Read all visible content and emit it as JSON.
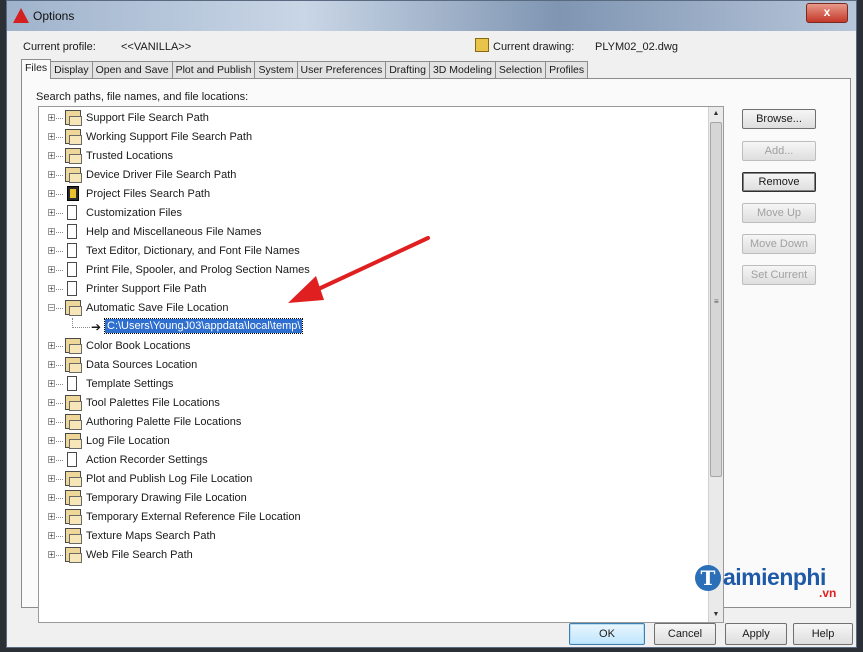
{
  "window": {
    "title": "Options",
    "close_glyph": "x"
  },
  "profile": {
    "label": "Current profile:",
    "value": "<<VANILLA>>",
    "drawing_label": "Current drawing:",
    "drawing_value": "PLYM02_02.dwg"
  },
  "tabs": [
    {
      "label": "Files",
      "active": true
    },
    {
      "label": "Display"
    },
    {
      "label": "Open and Save"
    },
    {
      "label": "Plot and Publish"
    },
    {
      "label": "System"
    },
    {
      "label": "User Preferences"
    },
    {
      "label": "Drafting"
    },
    {
      "label": "3D Modeling"
    },
    {
      "label": "Selection"
    },
    {
      "label": "Profiles"
    }
  ],
  "files": {
    "search_label": "Search paths, file names, and file locations:",
    "tree": [
      {
        "label": "Support File Search Path",
        "icon": "folder-icon"
      },
      {
        "label": "Working Support File Search Path",
        "icon": "folder-icon"
      },
      {
        "label": "Trusted Locations",
        "icon": "folder-icon"
      },
      {
        "label": "Device Driver File Search Path",
        "icon": "folder-icon"
      },
      {
        "label": "Project Files Search Path",
        "icon": "project-icon"
      },
      {
        "label": "Customization Files",
        "icon": "document-icon"
      },
      {
        "label": "Help and Miscellaneous File Names",
        "icon": "document-icon"
      },
      {
        "label": "Text Editor, Dictionary, and Font File Names",
        "icon": "document-icon"
      },
      {
        "label": "Print File, Spooler, and Prolog Section Names",
        "icon": "document-icon"
      },
      {
        "label": "Printer Support File Path",
        "icon": "document-icon"
      },
      {
        "label": "Automatic Save File Location",
        "icon": "folder-icon",
        "expanded": true
      },
      {
        "label": "C:\\Users\\YoungJ03\\appdata\\local\\temp\\",
        "child": true,
        "selected": true
      },
      {
        "label": "Color Book Locations",
        "icon": "folder-icon"
      },
      {
        "label": "Data Sources Location",
        "icon": "folder-icon"
      },
      {
        "label": "Template Settings",
        "icon": "document-icon"
      },
      {
        "label": "Tool Palettes File Locations",
        "icon": "folder-icon"
      },
      {
        "label": "Authoring Palette File Locations",
        "icon": "folder-icon"
      },
      {
        "label": "Log File Location",
        "icon": "folder-icon"
      },
      {
        "label": "Action Recorder Settings",
        "icon": "document-icon"
      },
      {
        "label": "Plot and Publish Log File Location",
        "icon": "folder-icon"
      },
      {
        "label": "Temporary Drawing File Location",
        "icon": "folder-icon"
      },
      {
        "label": "Temporary External Reference File Location",
        "icon": "folder-icon"
      },
      {
        "label": "Texture Maps Search Path",
        "icon": "folder-icon"
      },
      {
        "label": "Web File Search Path",
        "icon": "folder-icon"
      }
    ]
  },
  "side_buttons": [
    {
      "label": "Browse...",
      "enabled": true
    },
    {
      "label": "Add...",
      "enabled": false
    },
    {
      "label": "Remove",
      "enabled": true,
      "default": true
    },
    {
      "label": "Move Up",
      "enabled": false
    },
    {
      "label": "Move Down",
      "enabled": false
    },
    {
      "label": "Set Current",
      "enabled": false
    }
  ],
  "bottom_buttons": {
    "ok": "OK",
    "cancel": "Cancel",
    "apply": "Apply",
    "help": "Help"
  },
  "watermark": {
    "letter": "T",
    "text": "aimienphi",
    "suffix": ".vn"
  },
  "colors": {
    "selection": "#2f6fd0",
    "annotation_arrow": "#e02020",
    "watermark_blue": "#1e5aa8"
  }
}
